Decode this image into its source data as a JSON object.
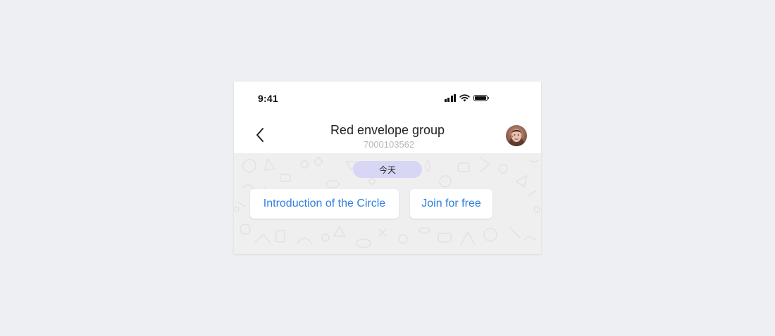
{
  "status_bar": {
    "time": "9:41"
  },
  "header": {
    "title": "Red envelope group",
    "subtitle": "7000103562",
    "back_icon": "chevron-left-icon",
    "avatar_icon": "user-avatar"
  },
  "chat": {
    "date_label": "今天",
    "quick_replies": [
      {
        "label": "Introduction of the Circle"
      },
      {
        "label": "Join for free"
      }
    ]
  },
  "colors": {
    "page_background": "#eeeff3",
    "chat_background": "#efefef",
    "date_pill": "#d7d6f5",
    "link_blue": "#2f7fe0"
  }
}
